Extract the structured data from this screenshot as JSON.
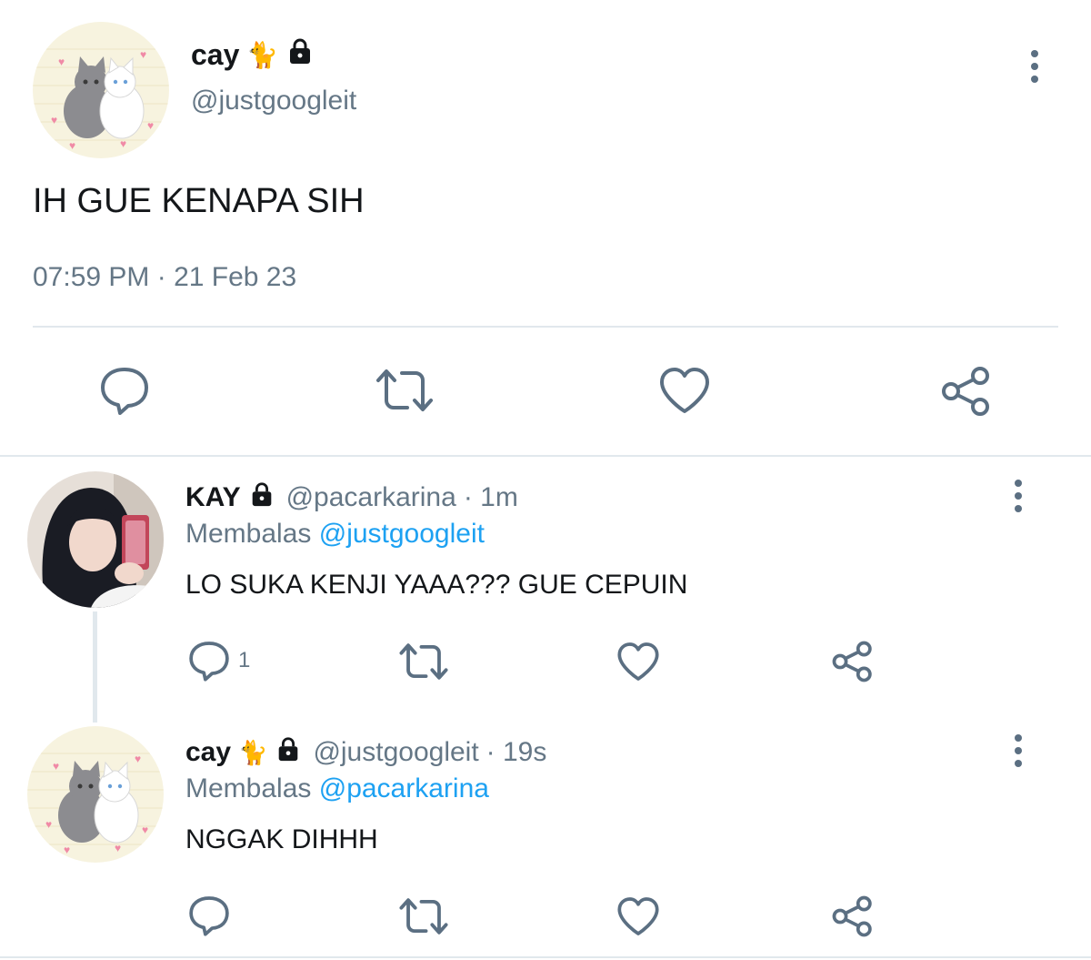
{
  "main_tweet": {
    "display_name": "cay",
    "name_emoji": "🐈",
    "handle": "@justgoogleit",
    "text": "IH GUE KENAPA SIH",
    "timestamp": "07:59 PM · 21 Feb 23",
    "avatar_icon": "cats-avatar",
    "locked_icon": "lock-icon"
  },
  "replies": [
    {
      "display_name": "KAY",
      "handle": "@pacarkarina",
      "time": "· 1m",
      "replying_label": "Membalas",
      "replying_to": "@justgoogleit",
      "text": "LO SUKA KENJI YAAA??? GUE CEPUIN",
      "reply_count": "1",
      "avatar_icon": "photo-avatar"
    },
    {
      "display_name": "cay",
      "name_emoji": "🐈",
      "handle": "@justgoogleit",
      "time": "· 19s",
      "replying_label": "Membalas",
      "replying_to": "@pacarkarina",
      "text": "NGGAK DIHHH",
      "reply_count": "",
      "avatar_icon": "cats-avatar"
    }
  ],
  "colors": {
    "text": "#14171a",
    "muted": "#657786",
    "link": "#1da1f2",
    "icon": "#5b6f82",
    "divider": "#e1e8ed"
  }
}
